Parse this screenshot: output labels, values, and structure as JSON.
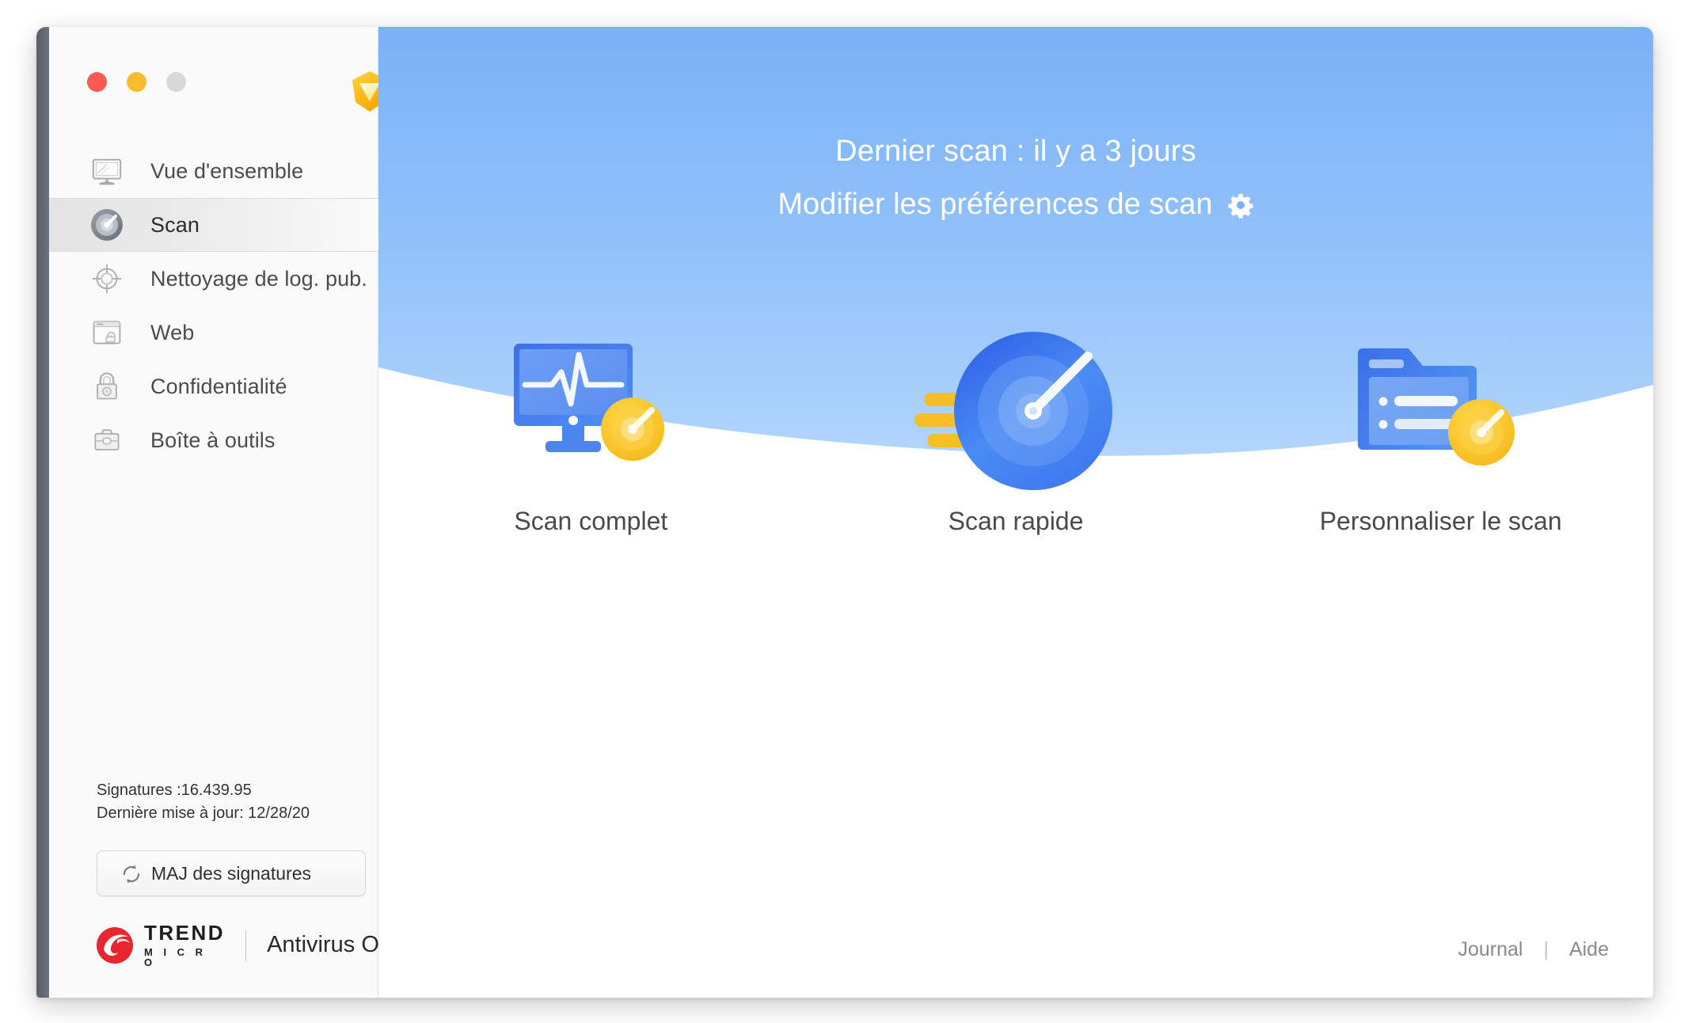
{
  "window": {
    "traffic_lights": [
      {
        "name": "close",
        "color": "#fa5a51"
      },
      {
        "name": "minimize",
        "color": "#f9bb2d"
      },
      {
        "name": "zoom",
        "color": "#d8d8d8"
      }
    ],
    "premium_badge_icon": "gem-icon"
  },
  "sidebar": {
    "items": [
      {
        "label": "Vue d'ensemble",
        "icon": "monitor-icon",
        "selected": false
      },
      {
        "label": "Scan",
        "icon": "gauge-icon",
        "selected": true
      },
      {
        "label": "Nettoyage de log. pub.",
        "icon": "crosshair-icon",
        "selected": false
      },
      {
        "label": "Web",
        "icon": "browser-window-icon",
        "selected": false
      },
      {
        "label": "Confidentialité",
        "icon": "padlock-icon",
        "selected": false
      },
      {
        "label": "Boîte à outils",
        "icon": "toolbox-icon",
        "selected": false
      }
    ],
    "signatures_line": "Signatures :16.439.95",
    "last_update_line": "Dernière mise à jour: 12/28/20",
    "update_button": {
      "label": "MAJ des signatures",
      "icon": "refresh-icon"
    },
    "brand": {
      "logo_icon": "trend-micro-logo-icon",
      "name_top": "TREND",
      "name_bottom": "M I C R O",
      "product": "Antivirus One",
      "accent_color": "#d71920"
    }
  },
  "main": {
    "hero": {
      "last_scan_text": "Dernier scan : il y a 3 jours",
      "preferences_text": "Modifier les préférences de scan",
      "preferences_icon": "gear-icon",
      "background_top_color": "#7fb4f8",
      "background_bottom_color": "#aed3fb"
    },
    "scan_options": [
      {
        "label": "Scan complet",
        "icon": "monitor-pulse-gauge-icon"
      },
      {
        "label": "Scan rapide",
        "icon": "speed-gauge-icon"
      },
      {
        "label": "Personnaliser le scan",
        "icon": "folder-list-gauge-icon"
      }
    ],
    "footer": {
      "log_link": "Journal",
      "separator": "|",
      "help_link": "Aide"
    }
  }
}
